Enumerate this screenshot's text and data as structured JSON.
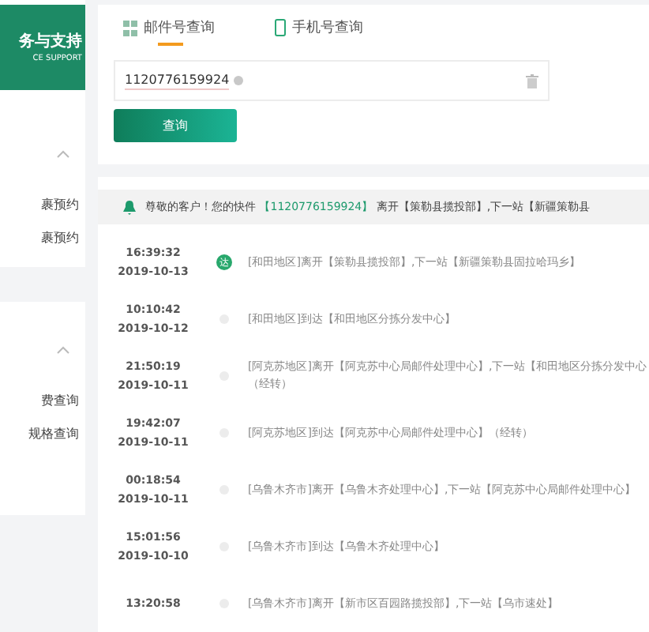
{
  "brand": {
    "title": "务与支持",
    "subtitle": "CE SUPPORT"
  },
  "sidebar": {
    "items": [
      {
        "kind": "chevron",
        "expanded": true
      },
      {
        "kind": "item",
        "label": "裹预约",
        "selected": false
      },
      {
        "kind": "item",
        "label": "裹预约",
        "selected": false
      },
      {
        "kind": "blank",
        "selected": true
      },
      {
        "kind": "chevron",
        "expanded": true
      },
      {
        "kind": "item",
        "label": "费查询",
        "selected": false
      },
      {
        "kind": "item",
        "label": "规格查询",
        "selected": false
      }
    ]
  },
  "tabs": [
    {
      "label": "邮件号查询",
      "selected": true
    },
    {
      "label": "手机号查询",
      "selected": false
    }
  ],
  "search": {
    "value": "1120776159924"
  },
  "query_button": "查询",
  "notice": {
    "prefix": "尊敬的客户！您的快件",
    "number": "【1120776159924】",
    "suffix": "离开【策勒县揽投部】,下一站【新疆策勒县"
  },
  "timeline": [
    {
      "time": "16:39:32",
      "date": "2019-10-13",
      "text": "[和田地区]离开【策勒县揽投部】,下一站【新疆策勒县固拉哈玛乡】",
      "current": true,
      "badge": "达"
    },
    {
      "time": "10:10:42",
      "date": "2019-10-12",
      "text": "[和田地区]到达【和田地区分拣分发中心】",
      "current": false
    },
    {
      "time": "21:50:19",
      "date": "2019-10-11",
      "text": "[阿克苏地区]离开【阿克苏中心局邮件处理中心】,下一站【和田地区分拣分发中心（经转）",
      "current": false
    },
    {
      "time": "19:42:07",
      "date": "2019-10-11",
      "text": "[阿克苏地区]到达【阿克苏中心局邮件处理中心】（经转）",
      "current": false
    },
    {
      "time": "00:18:54",
      "date": "2019-10-11",
      "text": "[乌鲁木齐市]离开【乌鲁木齐处理中心】,下一站【阿克苏中心局邮件处理中心】",
      "current": false
    },
    {
      "time": "15:01:56",
      "date": "2019-10-10",
      "text": "[乌鲁木齐市]到达【乌鲁木齐处理中心】",
      "current": false
    },
    {
      "time": "13:20:58",
      "text": "[乌鲁木齐市]离开【新市区百园路揽投部】,下一站【乌市速处】",
      "current": false
    }
  ]
}
